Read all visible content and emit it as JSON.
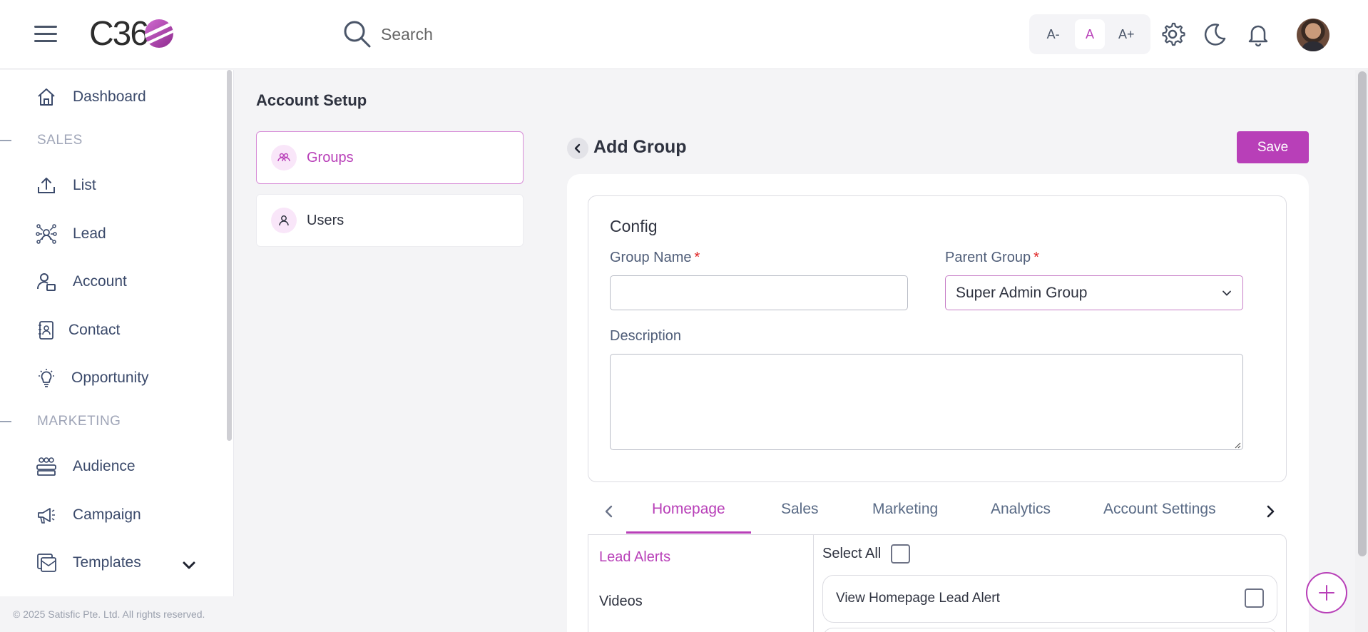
{
  "header": {
    "logo_text": "C36",
    "search_placeholder": "Search",
    "font_size_buttons": [
      "A-",
      "A",
      "A+"
    ],
    "active_font_size": "A",
    "icons": [
      "settings-icon",
      "dark-mode-icon",
      "notifications-icon"
    ]
  },
  "sidebar": {
    "items": [
      {
        "label": "Dashboard",
        "icon": "home-icon"
      },
      {
        "section": "SALES"
      },
      {
        "label": "List",
        "icon": "upload-icon"
      },
      {
        "label": "Lead",
        "icon": "network-icon"
      },
      {
        "label": "Account",
        "icon": "account-icon"
      },
      {
        "label": "Contact",
        "icon": "contact-icon"
      },
      {
        "label": "Opportunity",
        "icon": "bulb-icon"
      },
      {
        "section": "MARKETING"
      },
      {
        "label": "Audience",
        "icon": "audience-icon"
      },
      {
        "label": "Campaign",
        "icon": "megaphone-icon"
      },
      {
        "label": "Templates",
        "icon": "templates-icon",
        "expandable": true
      }
    ],
    "labels": {
      "dashboard": "Dashboard",
      "sales": "SALES",
      "list": "List",
      "lead": "Lead",
      "account": "Account",
      "contact": "Contact",
      "opportunity": "Opportunity",
      "marketing": "MARKETING",
      "audience": "Audience",
      "campaign": "Campaign",
      "templates": "Templates"
    },
    "footer": "© 2025 Satisfic Pte. Ltd. All rights reserved."
  },
  "main": {
    "page_title": "Account Setup",
    "nav": {
      "groups": "Groups",
      "users": "Users",
      "active": "Groups"
    },
    "form_title": "Add Group",
    "save_label": "Save",
    "config": {
      "title": "Config",
      "group_name_label": "Group Name",
      "group_name_value": "",
      "parent_group_label": "Parent Group",
      "parent_group_value": "Super Admin Group",
      "description_label": "Description",
      "description_value": "",
      "required_marker": "*"
    },
    "tabs": {
      "homepage": "Homepage",
      "sales": "Sales",
      "marketing": "Marketing",
      "analytics": "Analytics",
      "account_settings": "Account Settings",
      "active": "Homepage"
    },
    "permissions": {
      "categories": {
        "lead_alerts": "Lead Alerts",
        "videos": "Videos"
      },
      "active_category": "Lead Alerts",
      "select_all_label": "Select All",
      "select_all_checked": false,
      "rows": [
        {
          "label": "View Homepage Lead Alert",
          "checked": false
        }
      ]
    }
  },
  "colors": {
    "accent": "#b83fb8",
    "text": "#2f3340",
    "muted": "#4f5d78"
  }
}
